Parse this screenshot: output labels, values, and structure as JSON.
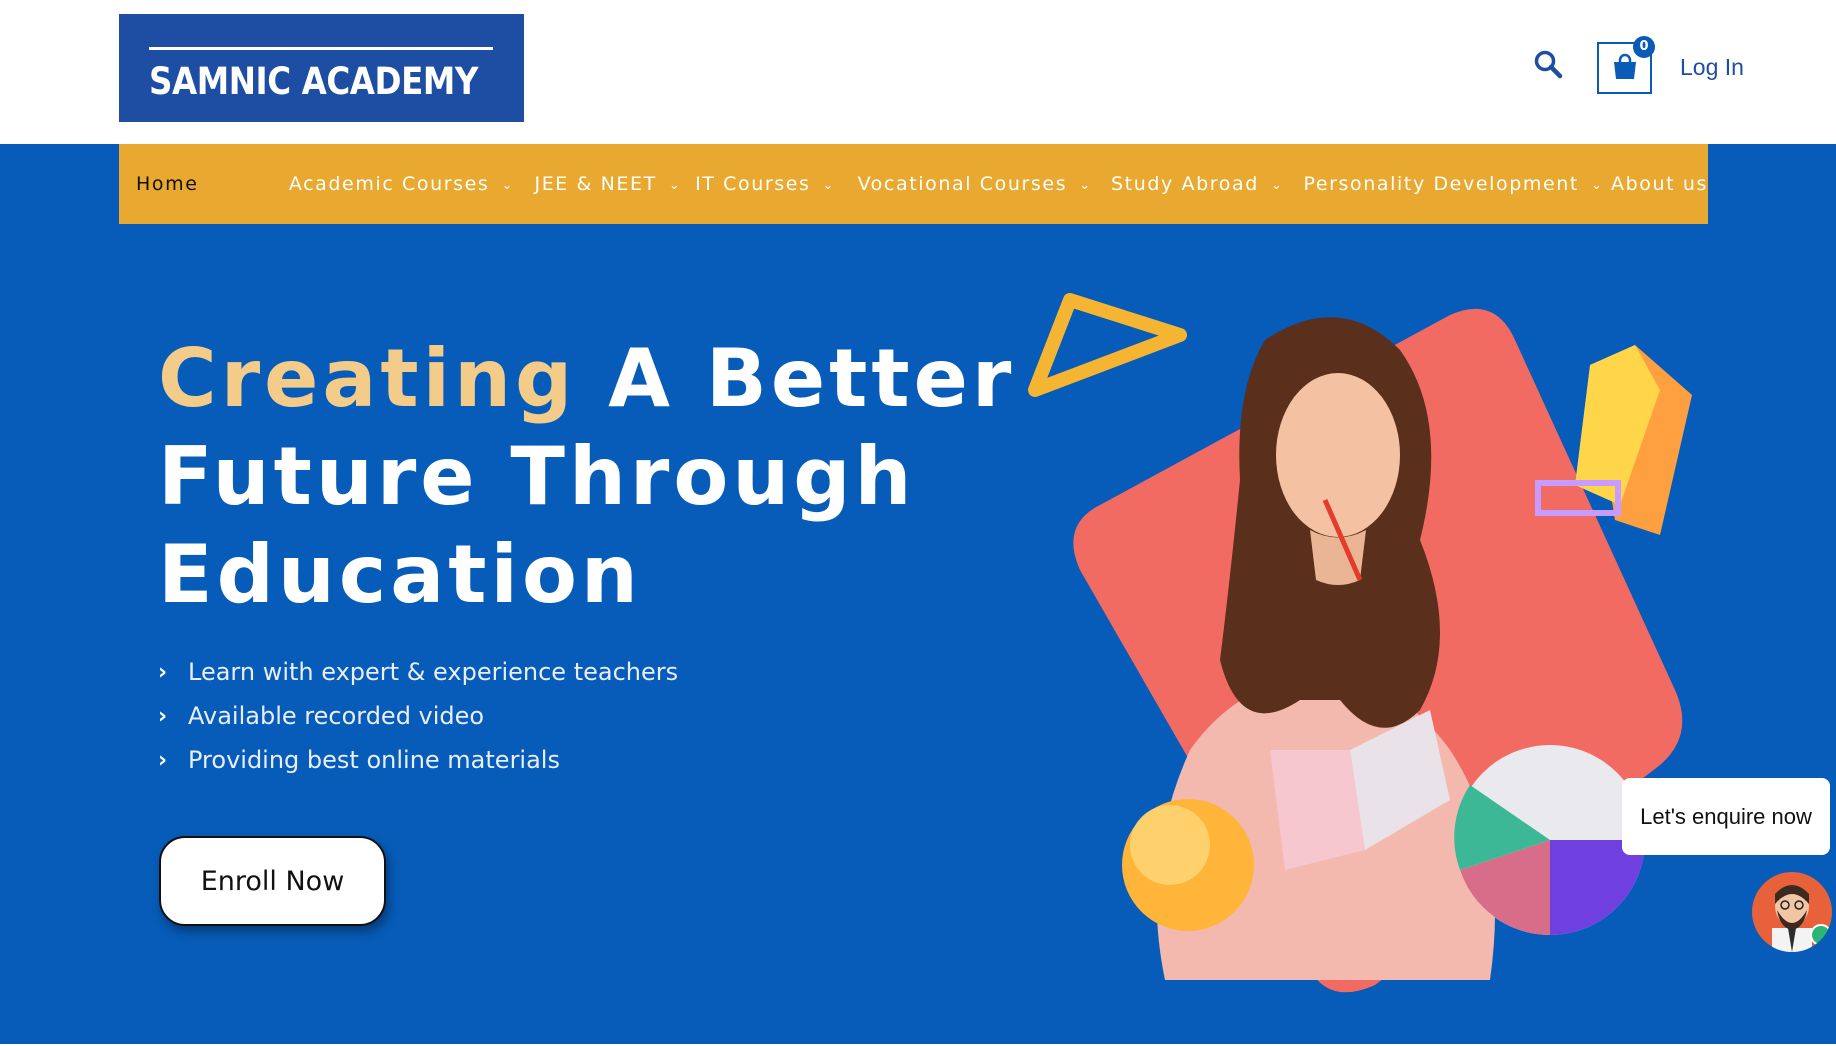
{
  "header": {
    "logo_text": "SAMNIC ACADEMY",
    "cart_count": "0",
    "login_label": "Log In",
    "search_icon": "search-icon",
    "cart_icon": "shopping-bag-icon"
  },
  "nav": {
    "items": [
      {
        "label": "Home",
        "dropdown": false,
        "active": true
      },
      {
        "label": "Academic Courses",
        "dropdown": true
      },
      {
        "label": "JEE & NEET",
        "dropdown": true
      },
      {
        "label": "IT Courses",
        "dropdown": true
      },
      {
        "label": "Vocational Courses",
        "dropdown": true
      },
      {
        "label": "Study Abroad",
        "dropdown": true
      },
      {
        "label": "Personality Development",
        "dropdown": true
      },
      {
        "label": "About us",
        "dropdown": false
      }
    ]
  },
  "hero": {
    "headline_accent": "Creating",
    "headline_line1_rest": " A Better",
    "headline_line2": "Future Through",
    "headline_line3": "Education",
    "bullets": [
      "Learn with expert & experience teachers",
      "Available recorded video",
      "Providing best online materials"
    ],
    "cta_label": "Enroll Now"
  },
  "chat": {
    "bubble_text": "Let's enquire now",
    "avatar_icon": "bearded-man-avatar-icon"
  },
  "colors": {
    "brand_blue": "#065cb8",
    "logo_blue": "#1e4ea3",
    "nav_orange": "#e9a82f",
    "accent_gold": "#f2cc88",
    "shape_coral": "#f26b63"
  }
}
